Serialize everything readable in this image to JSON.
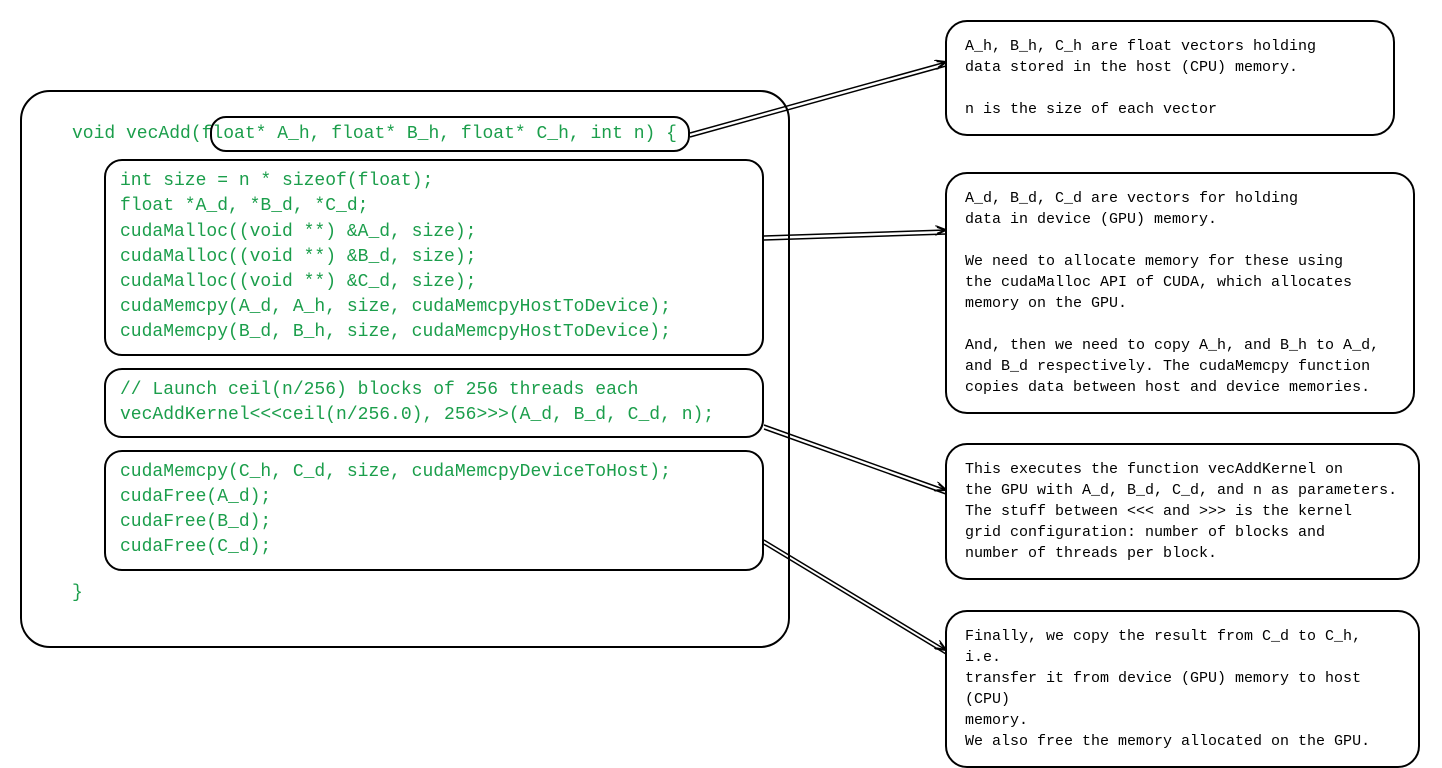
{
  "code": {
    "signature_full": "void vecAdd(float* A_h, float* B_h, float* C_h, int n) {",
    "block1": {
      "l1": "int size = n * sizeof(float);",
      "l2": "float *A_d, *B_d, *C_d;",
      "l3": "cudaMalloc((void **) &A_d, size);",
      "l4": "cudaMalloc((void **) &B_d, size);",
      "l5": "cudaMalloc((void **) &C_d, size);",
      "l6": "cudaMemcpy(A_d, A_h, size, cudaMemcpyHostToDevice);",
      "l7": "cudaMemcpy(B_d, B_h, size, cudaMemcpyHostToDevice);"
    },
    "block2": {
      "l1": "// Launch ceil(n/256) blocks of 256 threads each",
      "l2": "vecAddKernel<<<ceil(n/256.0), 256>>>(A_d, B_d, C_d, n);"
    },
    "block3": {
      "l1": "cudaMemcpy(C_h, C_d, size, cudaMemcpyDeviceToHost);",
      "l2": "cudaFree(A_d);",
      "l3": "cudaFree(B_d);",
      "l4": "cudaFree(C_d);"
    },
    "close_brace": "}"
  },
  "annotations": {
    "a1": "A_h, B_h, C_h are float vectors holding\ndata stored in the host (CPU) memory.\n\nn is the size of each vector",
    "a2": "A_d, B_d, C_d are vectors for holding\ndata in device (GPU) memory.\n\nWe need to allocate memory for these using\nthe cudaMalloc API of CUDA, which allocates\nmemory on the GPU.\n\nAnd, then we need to copy A_h, and B_h to A_d,\nand B_d respectively. The cudaMemcpy function\ncopies data between host and device memories.",
    "a3": "This executes the function vecAddKernel on\nthe GPU with A_d, B_d, C_d, and n as parameters.\nThe stuff between <<< and >>> is the kernel\ngrid configuration: number of blocks and\nnumber of threads per block.",
    "a4": "Finally, we copy the result from C_d to C_h, i.e.\ntransfer it from device (GPU) memory to host (CPU)\nmemory.\nWe also free the memory allocated on the GPU."
  }
}
